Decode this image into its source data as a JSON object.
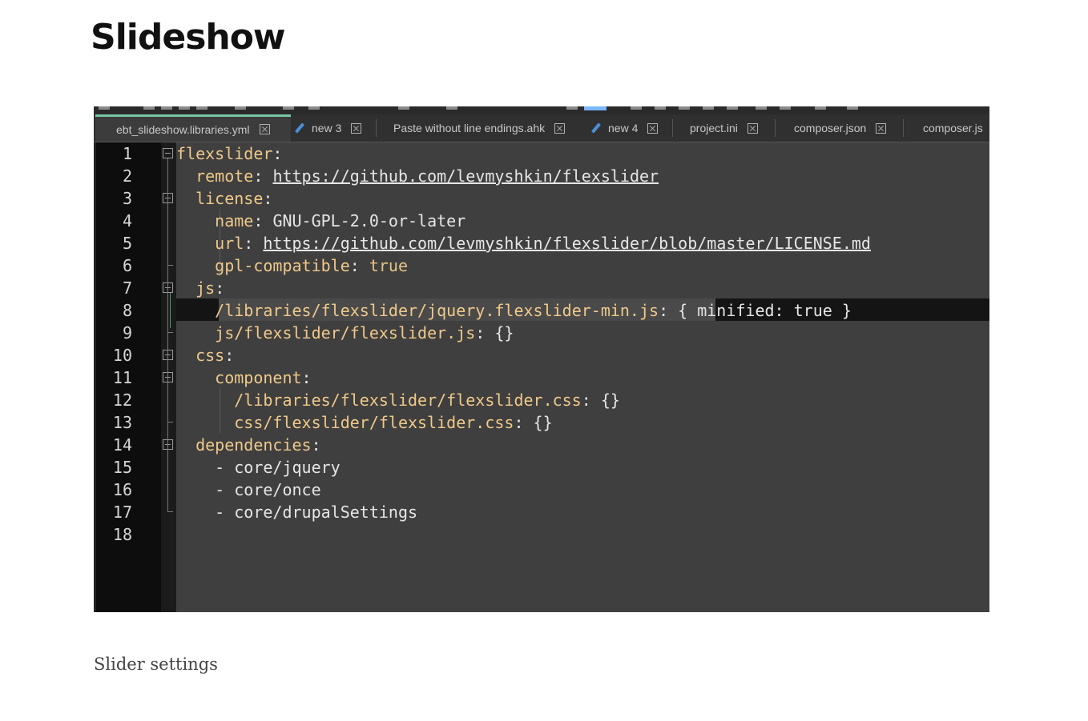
{
  "page": {
    "title": "Slideshow",
    "caption": "Slider settings"
  },
  "editor": {
    "tabs": [
      {
        "label": "ebt_slideshow.libraries.yml",
        "active": true,
        "modified": false
      },
      {
        "label": "new 3",
        "active": false,
        "modified": true
      },
      {
        "label": "Paste without line endings.ahk",
        "active": false,
        "modified": false
      },
      {
        "label": "new 4",
        "active": false,
        "modified": true
      },
      {
        "label": "project.ini",
        "active": false,
        "modified": false
      },
      {
        "label": "composer.json",
        "active": false,
        "modified": false
      },
      {
        "label": "composer.js",
        "active": false,
        "modified": false
      }
    ],
    "line_numbers": [
      "1",
      "2",
      "3",
      "4",
      "5",
      "6",
      "7",
      "8",
      "9",
      "10",
      "11",
      "12",
      "13",
      "14",
      "15",
      "16",
      "17",
      "18"
    ],
    "code": {
      "l1_key": "flexslider",
      "colon": ":",
      "l2_key": "remote",
      "l2_val": "https://github.com/levmyshkin/flexslider",
      "l3_key": "license",
      "l4_key": "name",
      "l4_val": "GNU-GPL-2.0-or-later",
      "l5_key": "url",
      "l5_val": "https://github.com/levmyshkin/flexslider/blob/master/LICENSE.md",
      "l6_key": "gpl-compatible",
      "l6_val": "true",
      "l7_key": "js",
      "l8_key": "/libraries/flexslider/jquery.flexslider-min.js",
      "l8_val": ": { minified: true }",
      "l9_key": "js/flexslider/flexslider.js",
      "l9_val": ": {}",
      "l10_key": "css",
      "l11_key": "component",
      "l12_key": "/libraries/flexslider/flexslider.css",
      "l12_val": ": {}",
      "l13_key": "css/flexslider/flexslider.css",
      "l13_val": ": {}",
      "l14_key": "dependencies",
      "l15_val": "- core/jquery",
      "l16_val": "- core/once",
      "l17_val": "- core/drupalSettings"
    },
    "colors": {
      "key": "#f0c98a",
      "background": "#3f3f3f",
      "gutter": "#0d0d0d",
      "active_tab_accent": "#78c8a8"
    }
  }
}
